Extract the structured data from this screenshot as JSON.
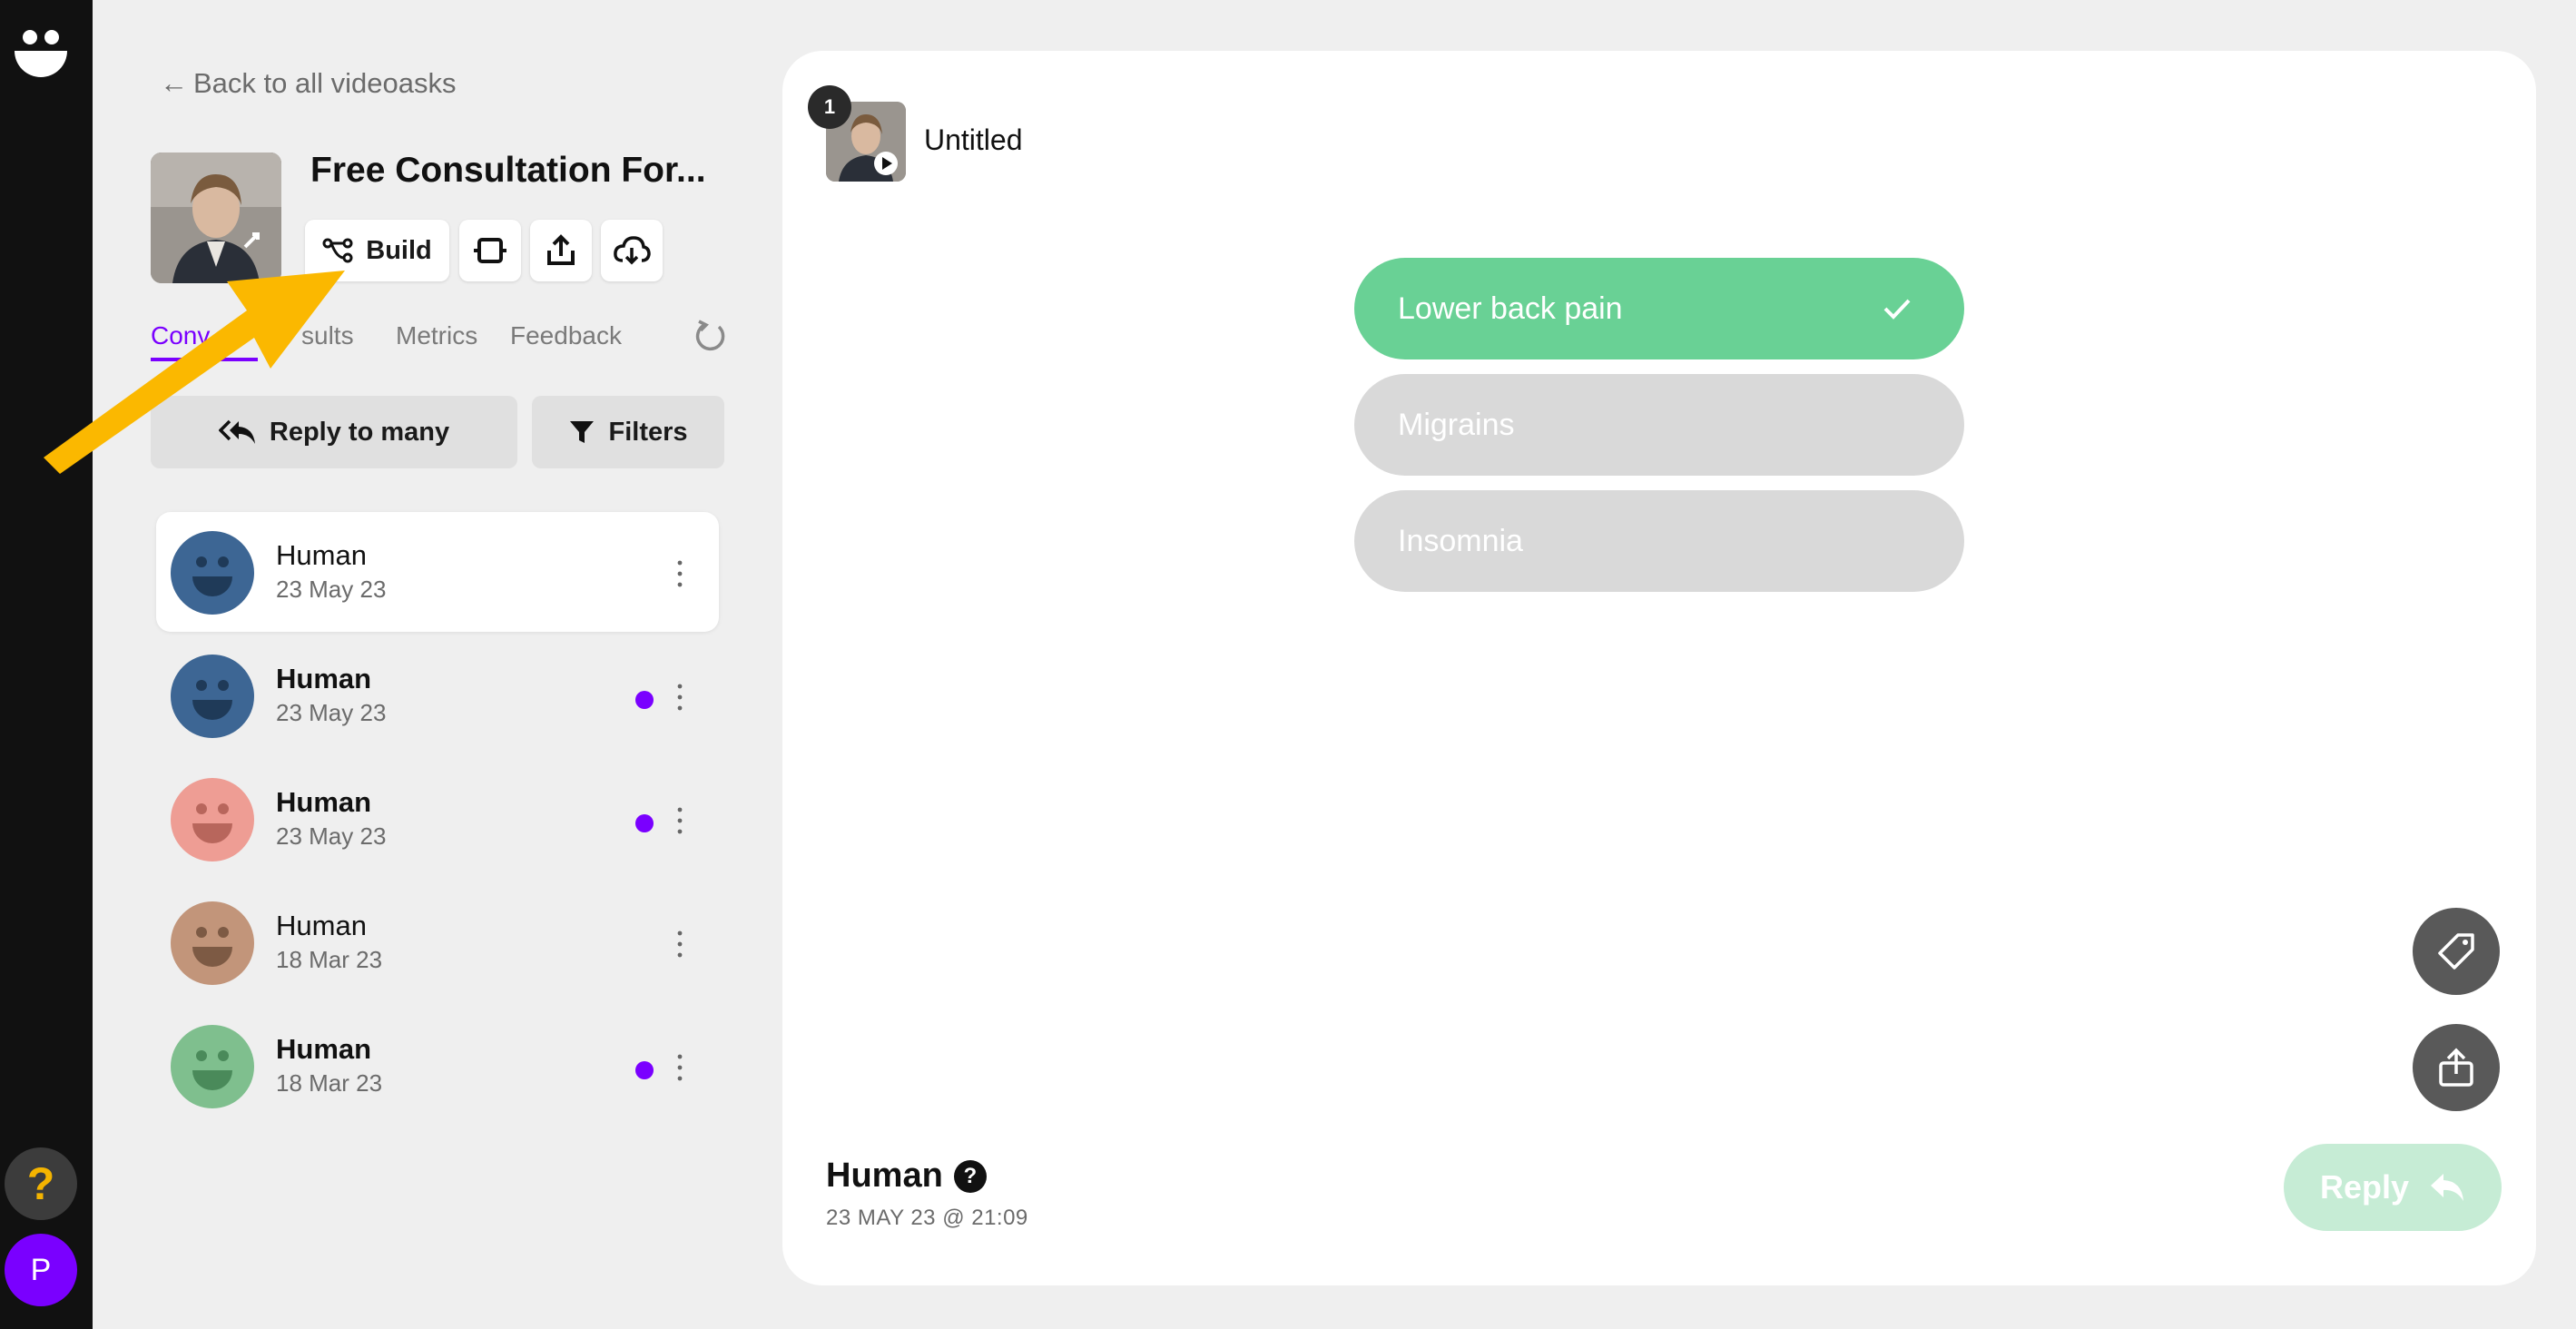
{
  "nav": {
    "back_label": "Back to all videoasks",
    "help_label": "?",
    "user_initial": "P"
  },
  "form": {
    "title": "Free Consultation For...",
    "build_label": "Build"
  },
  "tabs": [
    {
      "label": "Conversations",
      "visible_text": "Conv",
      "active": true
    },
    {
      "label": "Results",
      "visible_text": "sults",
      "active": false
    },
    {
      "label": "Metrics",
      "visible_text": "Metrics",
      "active": false
    },
    {
      "label": "Feedback",
      "visible_text": "Feedback",
      "active": false
    }
  ],
  "actions": {
    "reply_many": "Reply to many",
    "filters": "Filters"
  },
  "conversations": [
    {
      "name": "Human",
      "date": "23 May 23",
      "unread": false,
      "selected": true,
      "avatar_color": "#3d6694"
    },
    {
      "name": "Human",
      "date": "23 May 23",
      "unread": true,
      "selected": false,
      "avatar_color": "#3d6694"
    },
    {
      "name": "Human",
      "date": "23 May 23",
      "unread": true,
      "selected": false,
      "avatar_color": "#ee9d94"
    },
    {
      "name": "Human",
      "date": "18 Mar 23",
      "unread": false,
      "selected": false,
      "avatar_color": "#c2957a"
    },
    {
      "name": "Human",
      "date": "18 Mar 23",
      "unread": true,
      "selected": false,
      "avatar_color": "#7fbf8e"
    }
  ],
  "step": {
    "number": "1",
    "title": "Untitled"
  },
  "choices": [
    {
      "label": "Lower back pain",
      "selected": true
    },
    {
      "label": "Migrains",
      "selected": false
    },
    {
      "label": "Insomnia",
      "selected": false
    }
  ],
  "respondent": {
    "name": "Human",
    "timestamp": "23 MAY 23 @ 21:09",
    "help_label": "?"
  },
  "reply": {
    "label": "Reply"
  },
  "colors": {
    "accent": "#7a00ff",
    "selected_choice": "#69d195",
    "unselected_choice": "#d9d9d9",
    "reply_button": "#c6ecd5",
    "annotation_arrow": "#fbb800"
  },
  "icons": [
    "videoask-logo-icon",
    "arrow-left-icon",
    "flow-icon",
    "embed-icon",
    "share-icon",
    "cloud-download-icon",
    "refresh-icon",
    "reply-all-icon",
    "filter-icon",
    "more-vertical-icon",
    "check-icon",
    "tag-icon",
    "share-icon",
    "reply-icon",
    "help-icon"
  ]
}
